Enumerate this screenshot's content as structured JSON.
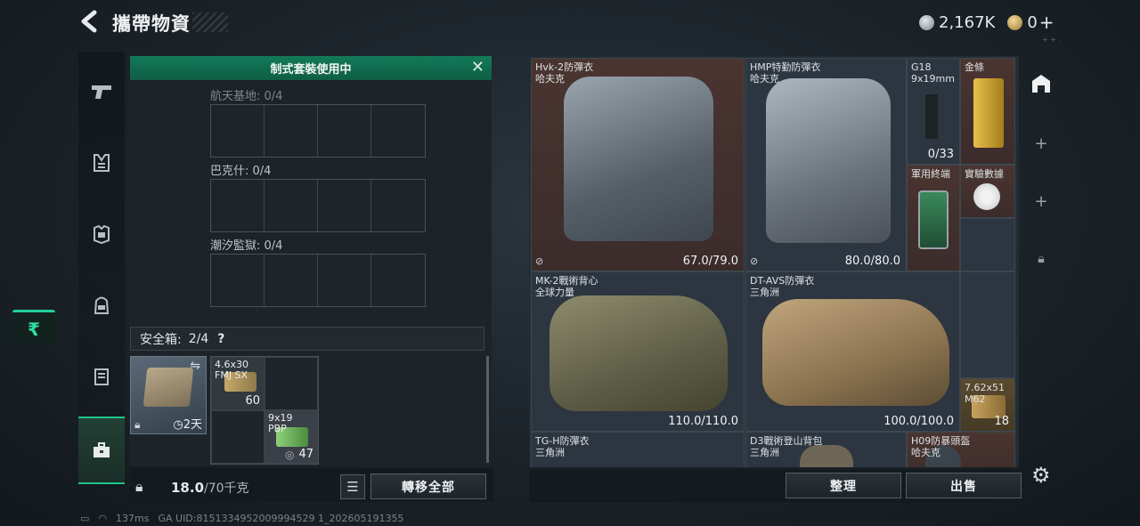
{
  "header": {
    "back_icon": "back-arrow-icon",
    "title": "攜帶物資",
    "silver_amount": "2,167K",
    "gold_amount": "0",
    "gold_add": "+",
    "watermark": "+ +  ."
  },
  "sidebar": {
    "items": [
      {
        "name": "weapon",
        "icon": "pistol-icon",
        "glyph": "⌐"
      },
      {
        "name": "chest-rig",
        "icon": "chest-rig-icon",
        "glyph": "Ѫ"
      },
      {
        "name": "armor",
        "icon": "armor-icon",
        "glyph": "⛨"
      },
      {
        "name": "backpack",
        "icon": "backpack-icon",
        "glyph": "◓"
      },
      {
        "name": "locker",
        "icon": "locker-icon",
        "glyph": "▤"
      },
      {
        "name": "case",
        "icon": "briefcase-icon",
        "glyph": "▣"
      }
    ],
    "rupee": "₹"
  },
  "left_panel": {
    "banner": "制式套裝使用中",
    "sections": [
      {
        "label": "航天基地: 0/4"
      },
      {
        "label": "巴克什: 0/4"
      },
      {
        "label": "潮汐監獄: 0/4"
      }
    ],
    "safebox_label": "安全箱:",
    "safebox_count": "2/4",
    "safebox_help": "?",
    "safe_timer": "2天",
    "ammo1": {
      "name": "4.6x30",
      "sub": "FMJ SX",
      "count": "60"
    },
    "ammo2": {
      "name": "9x19",
      "sub": "PBP",
      "count": "47"
    },
    "weight_value": "18.0",
    "weight_max": "/70千克",
    "transfer_all": "轉移全部"
  },
  "right_panel": {
    "items": [
      {
        "title": "Hvk-2防彈衣",
        "maker": "哈夫克",
        "durability": "67.0/79.0"
      },
      {
        "title": "HMP特勤防彈衣",
        "maker": "哈夫克",
        "durability": "80.0/80.0"
      },
      {
        "title": "G18",
        "maker": "9x19mm",
        "durability": "0/33"
      },
      {
        "title": "金條",
        "maker": "",
        "durability": ""
      },
      {
        "title": "軍用終端",
        "maker": "",
        "durability": ""
      },
      {
        "title": "實驗數據",
        "maker": "",
        "durability": ""
      },
      {
        "title": "MK-2戰術背心",
        "maker": "全球力量",
        "durability": "110.0/110.0"
      },
      {
        "title": "DT-AVS防彈衣",
        "maker": "三角洲",
        "durability": "100.0/100.0"
      },
      {
        "title": "7.62x51",
        "maker": "M62",
        "durability": "18"
      },
      {
        "title": "TG-H防彈衣",
        "maker": "三角洲",
        "durability": ""
      },
      {
        "title": "D3戰術登山背包",
        "maker": "三角洲",
        "durability": ""
      },
      {
        "title": "H09防暴頭盔",
        "maker": "哈夫克",
        "durability": ""
      }
    ],
    "sort_button": "整理",
    "sell_button": "出售"
  },
  "right_side": {
    "icons": [
      "storage-icon",
      "add-icon",
      "add-icon",
      "lock-icon"
    ]
  },
  "footer": {
    "signal": "137ms",
    "uid": "GA UID:8151334952009994529 1_202605191355"
  },
  "colors": {
    "accent": "#1fc28b",
    "banner": "#137a59",
    "danger_cell": "#4a3430"
  }
}
